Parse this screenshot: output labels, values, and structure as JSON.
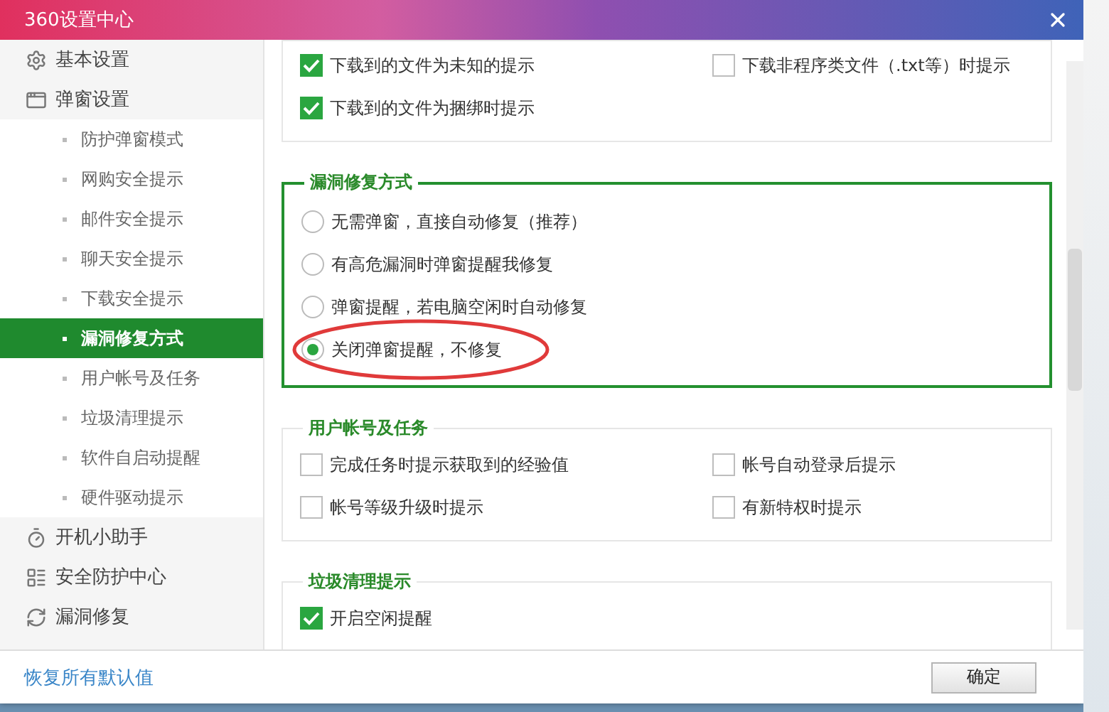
{
  "window": {
    "title": "360设置中心"
  },
  "sidebar": {
    "items": [
      {
        "label": "基本设置",
        "selected": false
      },
      {
        "label": "弹窗设置",
        "selected": false,
        "children": [
          {
            "label": "防护弹窗模式",
            "selected": false
          },
          {
            "label": "网购安全提示",
            "selected": false
          },
          {
            "label": "邮件安全提示",
            "selected": false
          },
          {
            "label": "聊天安全提示",
            "selected": false
          },
          {
            "label": "下载安全提示",
            "selected": false
          },
          {
            "label": "漏洞修复方式",
            "selected": true
          },
          {
            "label": "用户帐号及任务",
            "selected": false
          },
          {
            "label": "垃圾清理提示",
            "selected": false
          },
          {
            "label": "软件自启动提醒",
            "selected": false
          },
          {
            "label": "硬件驱动提示",
            "selected": false
          }
        ]
      },
      {
        "label": "开机小助手",
        "selected": false
      },
      {
        "label": "安全防护中心",
        "selected": false
      },
      {
        "label": "漏洞修复",
        "selected": false
      }
    ]
  },
  "sections": [
    {
      "kind": "checkbox",
      "focused": false,
      "options": [
        {
          "label": "下载到的文件为未知的提示",
          "checked": true
        },
        {
          "label": "下载非程序类文件（.txt等）时提示",
          "checked": false
        },
        {
          "label": "下载到的文件为捆绑时提示",
          "checked": true
        }
      ]
    },
    {
      "kind": "radio",
      "title": "漏洞修复方式",
      "focused": true,
      "options": [
        {
          "label": "无需弹窗，直接自动修复（推荐）",
          "selected": false,
          "circled": false
        },
        {
          "label": "有高危漏洞时弹窗提醒我修复",
          "selected": false,
          "circled": false
        },
        {
          "label": "弹窗提醒，若电脑空闲时自动修复",
          "selected": false,
          "circled": false
        },
        {
          "label": "关闭弹窗提醒，不修复",
          "selected": true,
          "circled": true
        }
      ]
    },
    {
      "kind": "checkbox",
      "title": "用户帐号及任务",
      "focused": false,
      "options": [
        {
          "label": "完成任务时提示获取到的经验值",
          "checked": false
        },
        {
          "label": "帐号自动登录后提示",
          "checked": false
        },
        {
          "label": "帐号等级升级时提示",
          "checked": false
        },
        {
          "label": "有新特权时提示",
          "checked": false
        }
      ]
    },
    {
      "kind": "checkbox",
      "title": "垃圾清理提示",
      "focused": false,
      "options": [
        {
          "label": "开启空闲提醒",
          "checked": true
        }
      ]
    }
  ],
  "footer": {
    "link": "恢复所有默认值",
    "button": "确定"
  }
}
